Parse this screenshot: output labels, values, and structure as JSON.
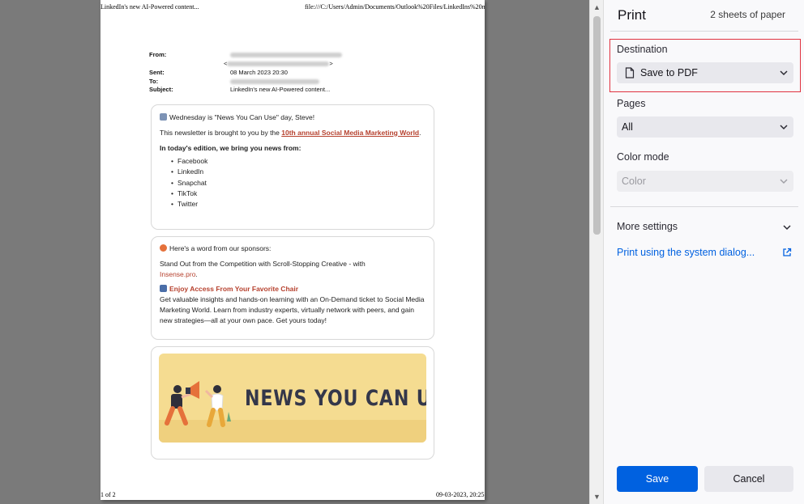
{
  "preview": {
    "header_left": "LinkedIn's new AI-Powered content...",
    "header_right": "file:///C:/Users/Admin/Documents/Outlook%20Files/LinkedIns%20n...",
    "footer_left": "1 of 2",
    "footer_right": "09-03-2023, 20:25",
    "email": {
      "from_label": "From:",
      "sent_label": "Sent:",
      "sent_value": "08 March 2023 20:30",
      "to_label": "To:",
      "subject_label": "Subject:",
      "subject_value": "LinkedIn's new AI-Powered content..."
    },
    "card1": {
      "greeting": "Wednesday is \"News You Can Use\" day, Steve!",
      "intro_text": "This newsletter is brought to you by the ",
      "intro_link": "10th annual Social Media Marketing World",
      "intro_end": ".",
      "edition_heading": "In today's edition, we bring you news from:",
      "items": [
        "Facebook",
        "LinkedIn",
        "Snapchat",
        "TikTok",
        "Twitter"
      ]
    },
    "card2": {
      "sponsor_line": "Here's a word from our sponsors:",
      "standout_text": "Stand Out from the Competition with Scroll-Stopping Creative - with",
      "standout_link": "Insense.pro",
      "standout_end": ".",
      "access_heading": "Enjoy Access From Your Favorite Chair",
      "access_body": "Get valuable insights and hands-on learning with an On-Demand ticket to Social Media Marketing World. Learn from industry experts, virtually network with peers, and gain new strategies—all at your own pace. Get yours today!"
    },
    "banner": {
      "title": "NEWS YOU CAN USE"
    }
  },
  "panel": {
    "title": "Print",
    "sheets": "2 sheets of paper",
    "destination_label": "Destination",
    "destination_value": "Save to PDF",
    "pages_label": "Pages",
    "pages_value": "All",
    "color_label": "Color mode",
    "color_value": "Color",
    "more_settings": "More settings",
    "system_dialog": "Print using the system dialog...",
    "save_button": "Save",
    "cancel_button": "Cancel"
  },
  "colors": {
    "accent_blue": "#0061e0",
    "highlight_red": "#e0313f",
    "newsletter_accent": "#b6412e"
  }
}
